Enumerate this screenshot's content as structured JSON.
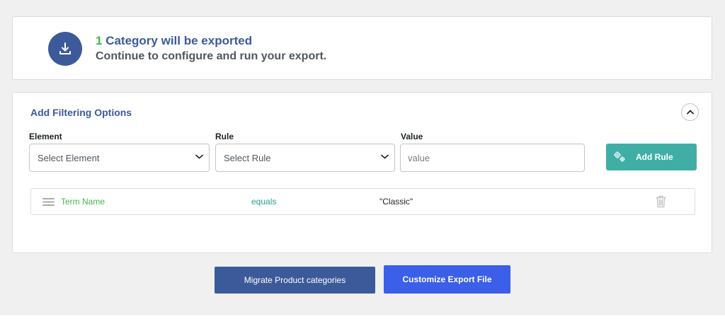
{
  "summary": {
    "count": "1",
    "title_rest": " Category will be exported",
    "subtitle": "Continue to configure and run your export.",
    "icon": "download-icon"
  },
  "filtering": {
    "title": "Add Filtering Options",
    "collapse_icon": "chevron-up-icon",
    "element": {
      "label": "Element",
      "selected": "Select Element"
    },
    "rule": {
      "label": "Rule",
      "selected": "Select Rule"
    },
    "value": {
      "label": "Value",
      "placeholder": "value"
    },
    "add_rule_label": "Add Rule",
    "rules": [
      {
        "element": "Term Name",
        "operator": "equals",
        "value": "\"Classic\""
      }
    ]
  },
  "actions": {
    "migrate_label": "Migrate Product categories",
    "customize_label": "Customize Export File"
  },
  "colors": {
    "primary": "#3c5a9a",
    "success": "#46b450",
    "teal": "#40aea5",
    "accent_blue": "#3b5fe8"
  }
}
